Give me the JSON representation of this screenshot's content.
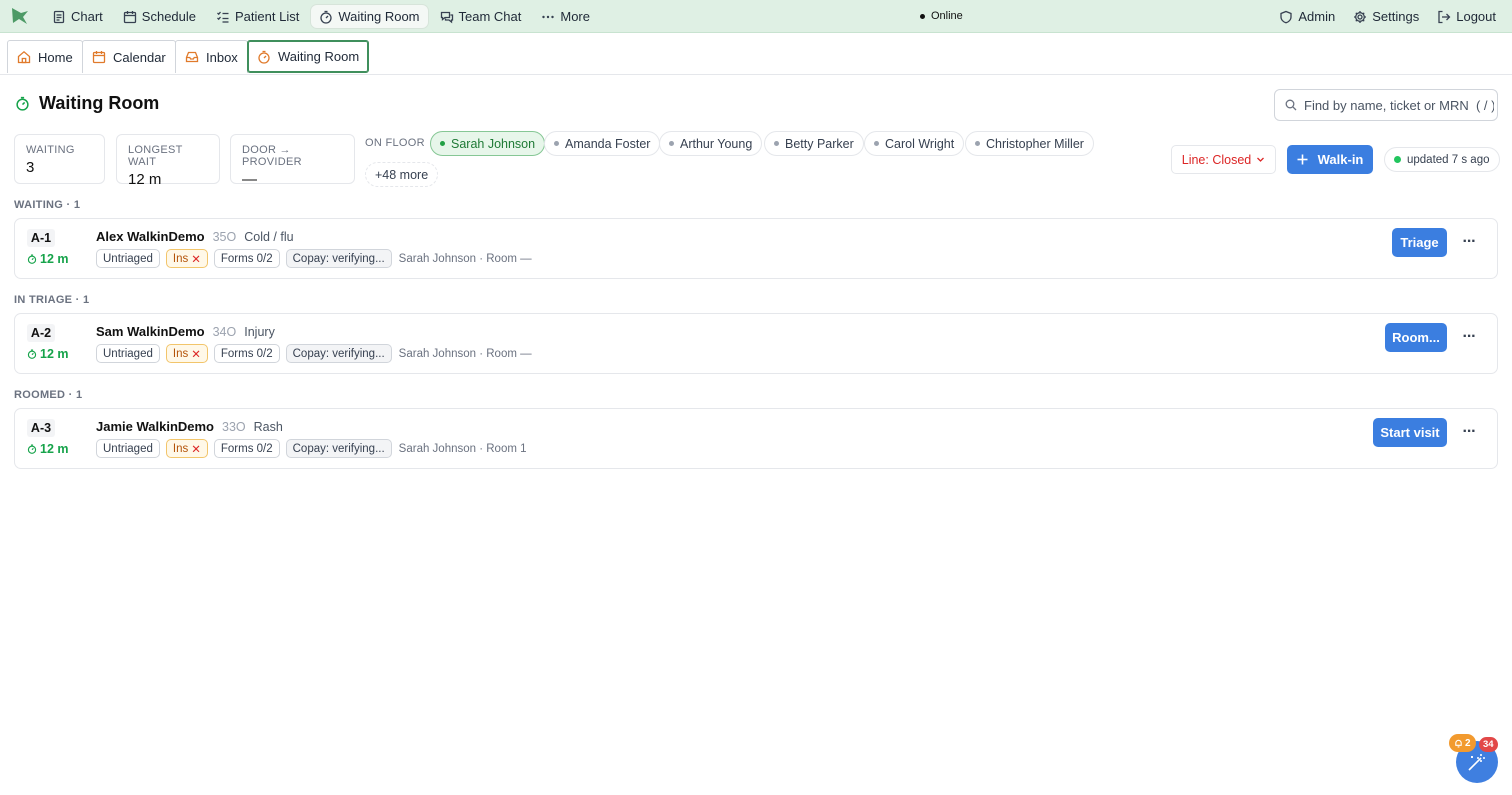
{
  "topnav": {
    "items": [
      {
        "label": "Chart",
        "icon": "document-icon"
      },
      {
        "label": "Schedule",
        "icon": "calendar-icon"
      },
      {
        "label": "Patient List",
        "icon": "list-check-icon"
      },
      {
        "label": "Waiting Room",
        "icon": "timer-icon",
        "active": true
      },
      {
        "label": "Team Chat",
        "icon": "chat-icon"
      },
      {
        "label": "More",
        "icon": "ellipsis-icon"
      }
    ],
    "status": "Online",
    "right": [
      {
        "label": "Admin",
        "icon": "shield-icon"
      },
      {
        "label": "Settings",
        "icon": "gear-icon"
      },
      {
        "label": "Logout",
        "icon": "logout-icon"
      }
    ]
  },
  "tabs": [
    {
      "label": "Home",
      "icon": "home-icon"
    },
    {
      "label": "Calendar",
      "icon": "calendar-icon"
    },
    {
      "label": "Inbox",
      "icon": "inbox-icon"
    },
    {
      "label": "Waiting Room",
      "icon": "timer-icon",
      "active": true
    }
  ],
  "page": {
    "title": "Waiting Room",
    "search_placeholder": "Find by name, ticket or MRN  ( / )"
  },
  "stats": {
    "waiting": {
      "label": "WAITING",
      "value": "3"
    },
    "longest": {
      "label": "LONGEST WAIT",
      "value": "12 m"
    },
    "door": {
      "label": "DOOR → PROVIDER",
      "value": "—"
    }
  },
  "on_floor": {
    "label": "ON FLOOR",
    "providers": [
      "Sarah Johnson",
      "Amanda Foster",
      "Arthur Young",
      "Betty Parker",
      "Carol Wright",
      "Christopher Miller"
    ],
    "more": "+48 more"
  },
  "controls": {
    "line": "Line: Closed",
    "walkin": "Walk-in",
    "updated": "updated 7 s ago"
  },
  "sections": [
    {
      "label": "WAITING · 1",
      "patients": [
        {
          "ticket": "A-1",
          "wait": "12 m",
          "name": "Alex WalkinDemo",
          "age": "35O",
          "reason": "Cold / flu",
          "triage": "Untriaged",
          "ins": "Ins",
          "forms": "Forms 0/2",
          "copay": "Copay: verifying...",
          "assign": "Sarah Johnson · Room —",
          "action": "Triage"
        }
      ]
    },
    {
      "label": "IN TRIAGE · 1",
      "patients": [
        {
          "ticket": "A-2",
          "wait": "12 m",
          "name": "Sam WalkinDemo",
          "age": "34O",
          "reason": "Injury",
          "triage": "Untriaged",
          "ins": "Ins",
          "forms": "Forms 0/2",
          "copay": "Copay: verifying...",
          "assign": "Sarah Johnson · Room —",
          "action": "Room..."
        }
      ]
    },
    {
      "label": "ROOMED · 1",
      "patients": [
        {
          "ticket": "A-3",
          "wait": "12 m",
          "name": "Jamie WalkinDemo",
          "age": "33O",
          "reason": "Rash",
          "triage": "Untriaged",
          "ins": "Ins",
          "forms": "Forms 0/2",
          "copay": "Copay: verifying...",
          "assign": "Sarah Johnson · Room 1",
          "action": "Start visit"
        }
      ]
    }
  ],
  "fab": {
    "bell_count": "2",
    "count": "34"
  },
  "colors": {
    "accent": "#3b7ee0",
    "topbar": "#dff0e4",
    "active_tab_border": "#3f8f5c",
    "success": "#16a34a",
    "danger": "#dc2626"
  }
}
